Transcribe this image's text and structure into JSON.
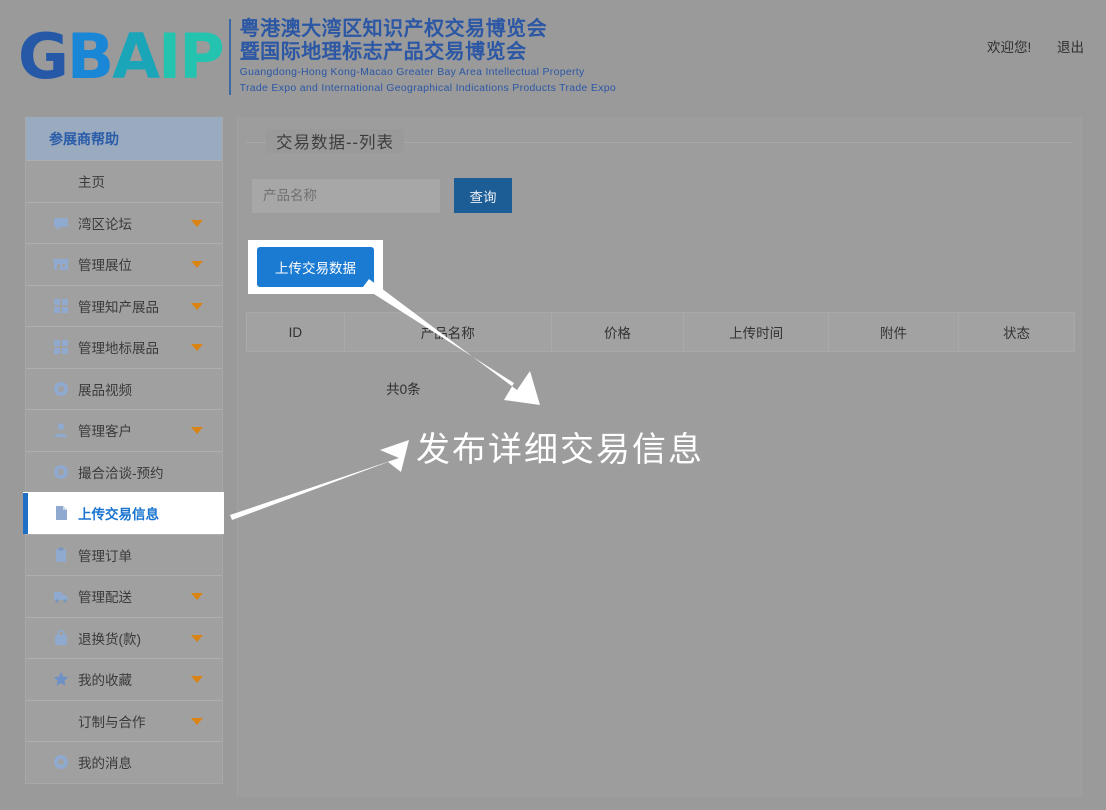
{
  "header": {
    "logo": {
      "mark_parts": [
        "G",
        "B",
        "A",
        "IP"
      ],
      "cn_line1": "粤港澳大湾区知识产权交易博览会",
      "cn_line2": "暨国际地理标志产品交易博览会",
      "en_line1": "Guangdong-Hong Kong-Macao Greater Bay Area Intellectual Property",
      "en_line2": "Trade Expo and International Geographical Indications Products Trade Expo"
    },
    "welcome": "欢迎您!",
    "logout": "退出"
  },
  "sidebar": {
    "title": "参展商帮助",
    "items": [
      {
        "label": "主页",
        "icon": "",
        "caret": false,
        "active": false
      },
      {
        "label": "湾区论坛",
        "icon": "forum-icon",
        "caret": true,
        "active": false
      },
      {
        "label": "管理展位",
        "icon": "booth-icon",
        "caret": true,
        "active": false
      },
      {
        "label": "管理知产展品",
        "icon": "grid-icon",
        "caret": true,
        "active": false
      },
      {
        "label": "管理地标展品",
        "icon": "grid-icon",
        "caret": true,
        "active": false
      },
      {
        "label": "展品视频",
        "icon": "circle-icon",
        "caret": false,
        "active": false
      },
      {
        "label": "管理客户",
        "icon": "user-icon",
        "caret": true,
        "active": false
      },
      {
        "label": "撮合洽谈-预约",
        "icon": "circle-icon",
        "caret": false,
        "active": false
      },
      {
        "label": "上传交易信息",
        "icon": "document-icon",
        "caret": false,
        "active": true
      },
      {
        "label": "管理订单",
        "icon": "clipboard-icon",
        "caret": false,
        "active": false
      },
      {
        "label": "管理配送",
        "icon": "truck-icon",
        "caret": true,
        "active": false
      },
      {
        "label": "退换货(款)",
        "icon": "return-icon",
        "caret": true,
        "active": false
      },
      {
        "label": "我的收藏",
        "icon": "star-icon",
        "caret": true,
        "active": false
      },
      {
        "label": "订制与合作",
        "icon": "",
        "caret": true,
        "active": false
      },
      {
        "label": "我的消息",
        "icon": "circle-icon",
        "caret": false,
        "active": false
      }
    ]
  },
  "main": {
    "legend": "交易数据--列表",
    "search": {
      "placeholder": "产品名称",
      "value": "",
      "button_label": "查询"
    },
    "upload_button_label": "上传交易数据",
    "table": {
      "columns": [
        "ID",
        "产品名称",
        "价格",
        "上传时间",
        "附件",
        "状态"
      ],
      "rows": [],
      "count_text": "共0条"
    }
  },
  "annotation": {
    "text": "发布详细交易信息",
    "color": "#ffffff"
  },
  "colors": {
    "page_overlay": "#9a9a9a",
    "brand_blue": "#2b57a5",
    "accent_blue": "#1b7ad1",
    "search_button": "#1d5d96",
    "caret_orange": "#d98413",
    "sidebar_header": "#9aabc0",
    "active_border": "#1f6fc4"
  }
}
